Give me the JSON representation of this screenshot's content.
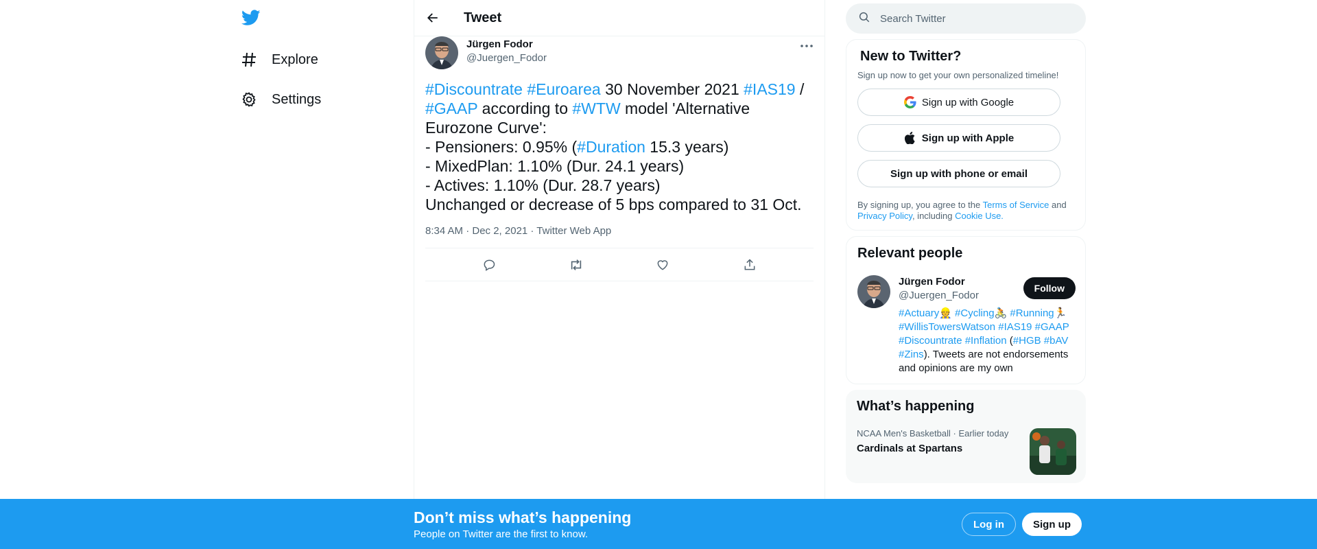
{
  "nav": {
    "logo_icon": "twitter-bird-icon",
    "items": [
      {
        "label": "Explore",
        "icon": "hashtag-icon"
      },
      {
        "label": "Settings",
        "icon": "gear-icon"
      }
    ]
  },
  "header": {
    "title": "Tweet"
  },
  "tweet": {
    "author_name": "Jürgen Fodor",
    "author_handle": "@Juergen_Fodor",
    "text_parts": [
      [
        "#Discountrate",
        " ",
        "#Euroarea",
        " 30 November 2021 ",
        "#IAS19",
        " /"
      ],
      [
        "#GAAP",
        " according to ",
        "#WTW",
        " model 'Alternative"
      ],
      [
        "Eurozone Curve':"
      ],
      [
        "- Pensioners: 0.95% (",
        "#Duration",
        " 15.3 years)"
      ],
      [
        "- MixedPlan: 1.10% (Dur. 24.1 years)"
      ],
      [
        "- Actives: 1.10% (Dur. 28.7 years)"
      ],
      [
        "Unchanged or decrease of 5 bps compared to 31 Oct."
      ]
    ],
    "timestamp": "8:34 AM · Dec 2, 2021 · Twitter Web App"
  },
  "search": {
    "placeholder": "Search Twitter"
  },
  "signup": {
    "title": "New to Twitter?",
    "subtitle": "Sign up now to get your own personalized timeline!",
    "google": "Sign up with Google",
    "apple": "Sign up with Apple",
    "phone": "Sign up with phone or email",
    "terms_prefix": "By signing up, you agree to the ",
    "terms_link": "Terms of Service",
    "terms_and": " and",
    "privacy_link": "Privacy Policy",
    "terms_including": ", including ",
    "cookie_link": "Cookie Use."
  },
  "relevant": {
    "title": "Relevant people",
    "name": "Jürgen Fodor",
    "handle": "@Juergen_Fodor",
    "follow": "Follow",
    "bio_line1": "#Actuary👷 #Cycling🚴 #Running🏃",
    "bio_line2": "#WillisTowersWatson #IAS19 #GAAP",
    "bio_line3a": "#Discountrate #Inflation",
    "bio_line3b": " (",
    "bio_line3c": "#HGB #bAV",
    "bio_line4a": "#Zins",
    "bio_line4b": "). Tweets are not endorsements",
    "bio_line5": "and opinions are my own"
  },
  "happening": {
    "title": "What’s happening",
    "trend_category": "NCAA Men's Basketball",
    "trend_time": "Earlier today",
    "trend_title": "Cardinals at Spartans"
  },
  "bottom_bar": {
    "title": "Don’t miss what’s happening",
    "subtitle": "People on Twitter are the first to know.",
    "login": "Log in",
    "signup": "Sign up"
  },
  "colors": {
    "accent": "#1d9bf0",
    "text": "#0f1419",
    "secondary": "#536471"
  }
}
